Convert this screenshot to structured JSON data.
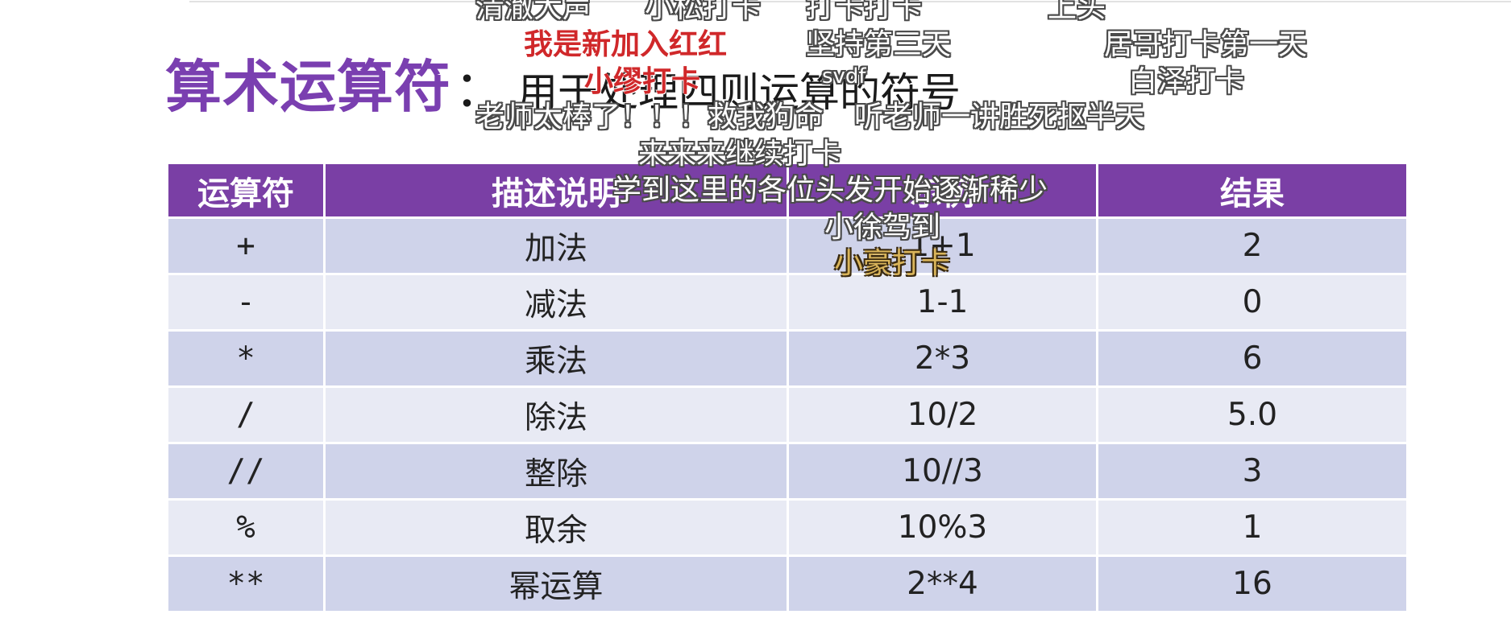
{
  "title": {
    "main": "算术运算符",
    "colon": "：",
    "subtitle": "用于处理四则运算的符号"
  },
  "table": {
    "headers": [
      "运算符",
      "描述说明",
      "示例",
      "结果"
    ],
    "rows": [
      [
        "+",
        "加法",
        "1+1",
        "2"
      ],
      [
        "-",
        "减法",
        "1-1",
        "0"
      ],
      [
        "*",
        "乘法",
        "2*3",
        "6"
      ],
      [
        "/",
        "除法",
        "10/2",
        "5.0"
      ],
      [
        "//",
        "整除",
        "10//3",
        "3"
      ],
      [
        "%",
        "取余",
        "10%3",
        "1"
      ],
      [
        "**",
        "幂运算",
        "2**4",
        "16"
      ]
    ]
  },
  "danmaku": {
    "d1": "清澈大声",
    "d2": "小松打卡",
    "d3": "打卡打卡",
    "d4": "上头",
    "d5": "我是新加入红红",
    "d6": "坚持第三天",
    "d7": "居哥打卡第一天",
    "d8": "小缪打卡",
    "d9": "svdf",
    "d10": "白泽打卡",
    "d11": "老师太棒了！！！救我狗命",
    "d12": "听老师一讲胜死抠半天",
    "d13": "来来来继续打卡",
    "d14": "学到这里的各位头发开始逐渐稀少",
    "d15": "小徐驾到",
    "d16": "小豪打卡"
  },
  "colors": {
    "title": "#7a3fb0",
    "header_bg": "#7a3fa5",
    "row_odd": "#cfd3ea",
    "row_even": "#e8eaf4"
  }
}
